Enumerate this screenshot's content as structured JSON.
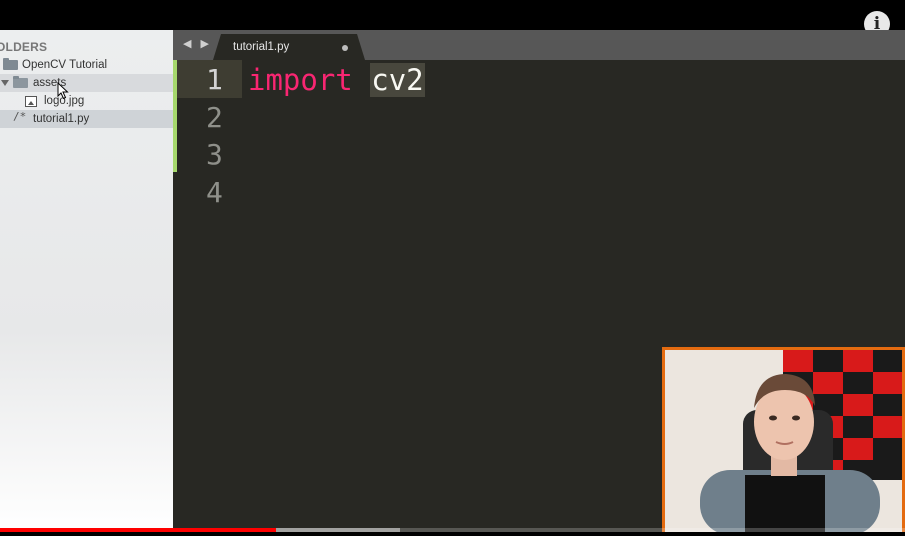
{
  "sidebar": {
    "header": "OLDERS",
    "project": "OpenCV Tutorial",
    "items": [
      {
        "label": "assets",
        "type": "folder"
      },
      {
        "label": "logo.jpg",
        "type": "image"
      },
      {
        "label": "tutorial1.py",
        "type": "file"
      }
    ],
    "file_glyph": "/*"
  },
  "tabbar": {
    "nav": "◀ ▶",
    "tab_label": "tutorial1.py"
  },
  "editor": {
    "line_numbers": [
      "1",
      "2",
      "3",
      "4"
    ],
    "code": {
      "keyword": "import",
      "module": "cv2"
    },
    "colors": {
      "background": "#282823",
      "keyword": "#f92672",
      "gutter": "#8f908a",
      "modified_marker": "#a6d86d"
    }
  },
  "player": {
    "info_button": "i",
    "progress_played": 0.305,
    "progress_buffered": 0.442,
    "accent": "#ff0000"
  },
  "webcam": {
    "border_color": "#e46b10"
  }
}
